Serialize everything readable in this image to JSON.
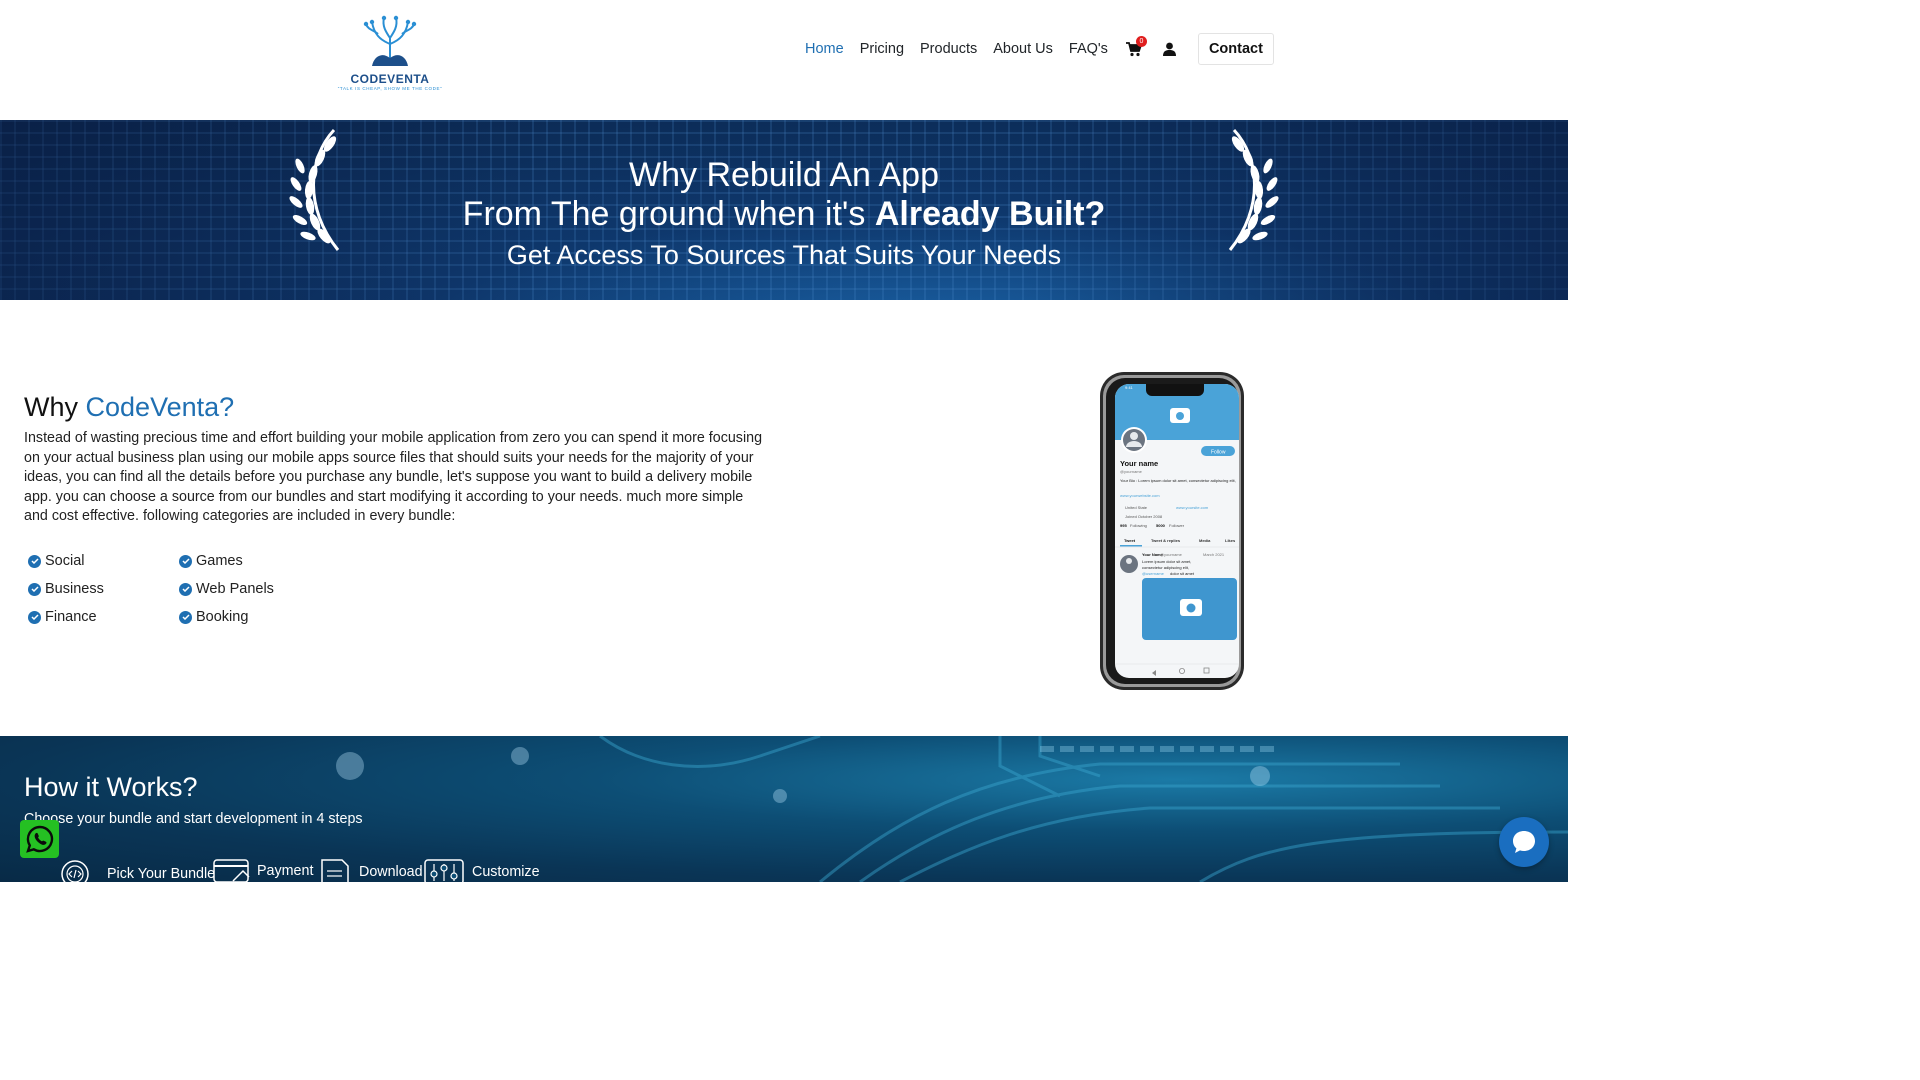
{
  "logo": {
    "name": "CODEVENTA",
    "tagline": "\"TALK IS CHEAP, SHOW ME THE CODE\""
  },
  "nav": {
    "items": [
      {
        "label": "Home",
        "active": true
      },
      {
        "label": "Pricing"
      },
      {
        "label": "Products"
      },
      {
        "label": "About Us"
      },
      {
        "label": "FAQ's"
      }
    ],
    "cart_count": "0",
    "contact_label": "Contact",
    "icons": [
      "cart-icon",
      "user-icon"
    ]
  },
  "hero": {
    "line1": "Why Rebuild An App",
    "line2_prefix": "From The ground when it's ",
    "line2_bold": "Already Built?",
    "line3": "Get Access To Sources That Suits Your Needs"
  },
  "why": {
    "title_prefix": "Why ",
    "title_brand": "CodeVenta?",
    "text": "Instead of wasting precious time and effort building your mobile application from zero you can spend it more focusing on your actual business plan using our mobile apps source files that should suits your needs for the majority of your ideas, you can find all the details before you purchase any bundle, let's suppose you want to build a delivery mobile app. you can choose a source from our bundles and start modifying it according to your needs. much more simple and cost effective. following categories are included in every bundle:",
    "categories_col1": [
      "Social",
      "Business",
      "Finance"
    ],
    "categories_col2": [
      "Games",
      "Web Panels",
      "Booking"
    ]
  },
  "phone_mock": {
    "name": "Your name",
    "handle": "@yourname",
    "bio": "Your Bio : Lorem ipsum dolor sit amet, consectetur adipiscing elit,",
    "link": "www.yourwebsite.com",
    "location": "United State",
    "website": "www.yoursite.com",
    "joined": "Joined October 2008",
    "following": "995",
    "following_label": "Following",
    "followers": "5000",
    "followers_label": "Follower",
    "follow_button": "Follow",
    "tabs": [
      "Tweet",
      "Tweet & replies",
      "Media",
      "Likes"
    ],
    "tweet_name": "Your Name",
    "tweet_handle": "@yourname",
    "tweet_date": "March 2021",
    "tweet_text1": "Lorem ipsum dolor sit amet,",
    "tweet_text2": "consectetur adipiscing elit,",
    "tweet_text3": "dolor sit amet",
    "tweet_mention": "@username",
    "time": "9:41"
  },
  "how": {
    "title": "How it Works?",
    "subtitle": "Choose your bundle and start development in 4 steps",
    "steps": [
      "Pick Your Bundle",
      "Payment",
      "Download",
      "Customize"
    ]
  },
  "colors": {
    "brand": "#1f6fb2",
    "whatsapp": "#25c023",
    "chat": "#1a6ec0",
    "badge": "#e01e1e"
  }
}
